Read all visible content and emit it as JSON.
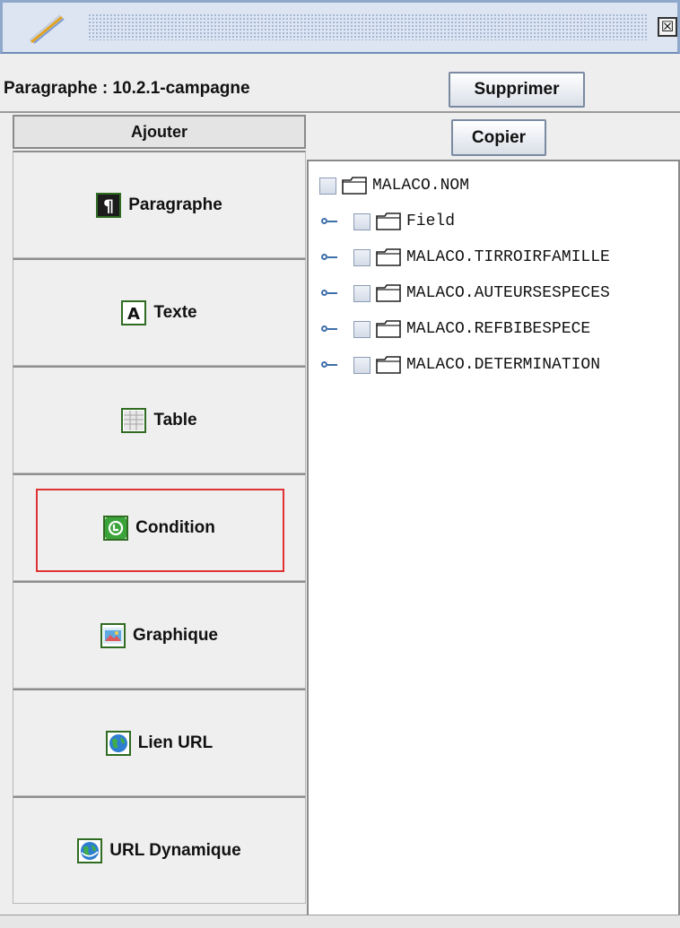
{
  "window": {
    "close_symbol": "☒",
    "icons": {
      "app": "pen-icon",
      "close": "close-icon"
    }
  },
  "header": {
    "paragraph_label": "Paragraphe : 10.2.1-campagne",
    "delete_label": "Supprimer"
  },
  "left_panel": {
    "add_header": "Ajouter",
    "buttons": [
      {
        "label": "Paragraphe",
        "icon": "pilcrow-icon"
      },
      {
        "label": "Texte",
        "icon": "text-a-icon"
      },
      {
        "label": "Table",
        "icon": "table-icon"
      },
      {
        "label": "Condition",
        "icon": "condition-icon",
        "highlighted": true
      },
      {
        "label": "Graphique",
        "icon": "image-icon"
      },
      {
        "label": "Lien URL",
        "icon": "globe-icon"
      },
      {
        "label": "URL Dynamique",
        "icon": "globe-dynamic-icon"
      }
    ]
  },
  "right_panel": {
    "copy_label": "Copier",
    "tree": [
      {
        "label": "MALACO.NOM",
        "level": 0,
        "has_handle": false
      },
      {
        "label": "Field",
        "level": 1,
        "has_handle": true
      },
      {
        "label": "MALACO.TIRROIRFAMILLE",
        "level": 1,
        "has_handle": true
      },
      {
        "label": "MALACO.AUTEURSESPECES",
        "level": 1,
        "has_handle": true
      },
      {
        "label": "MALACO.REFBIBESPECE",
        "level": 1,
        "has_handle": true
      },
      {
        "label": "MALACO.DETERMINATION",
        "level": 1,
        "has_handle": true
      }
    ]
  },
  "colors": {
    "highlight": "#e03232",
    "icon_border": "#2f6b21",
    "tree_handle": "#3e6fa8"
  }
}
